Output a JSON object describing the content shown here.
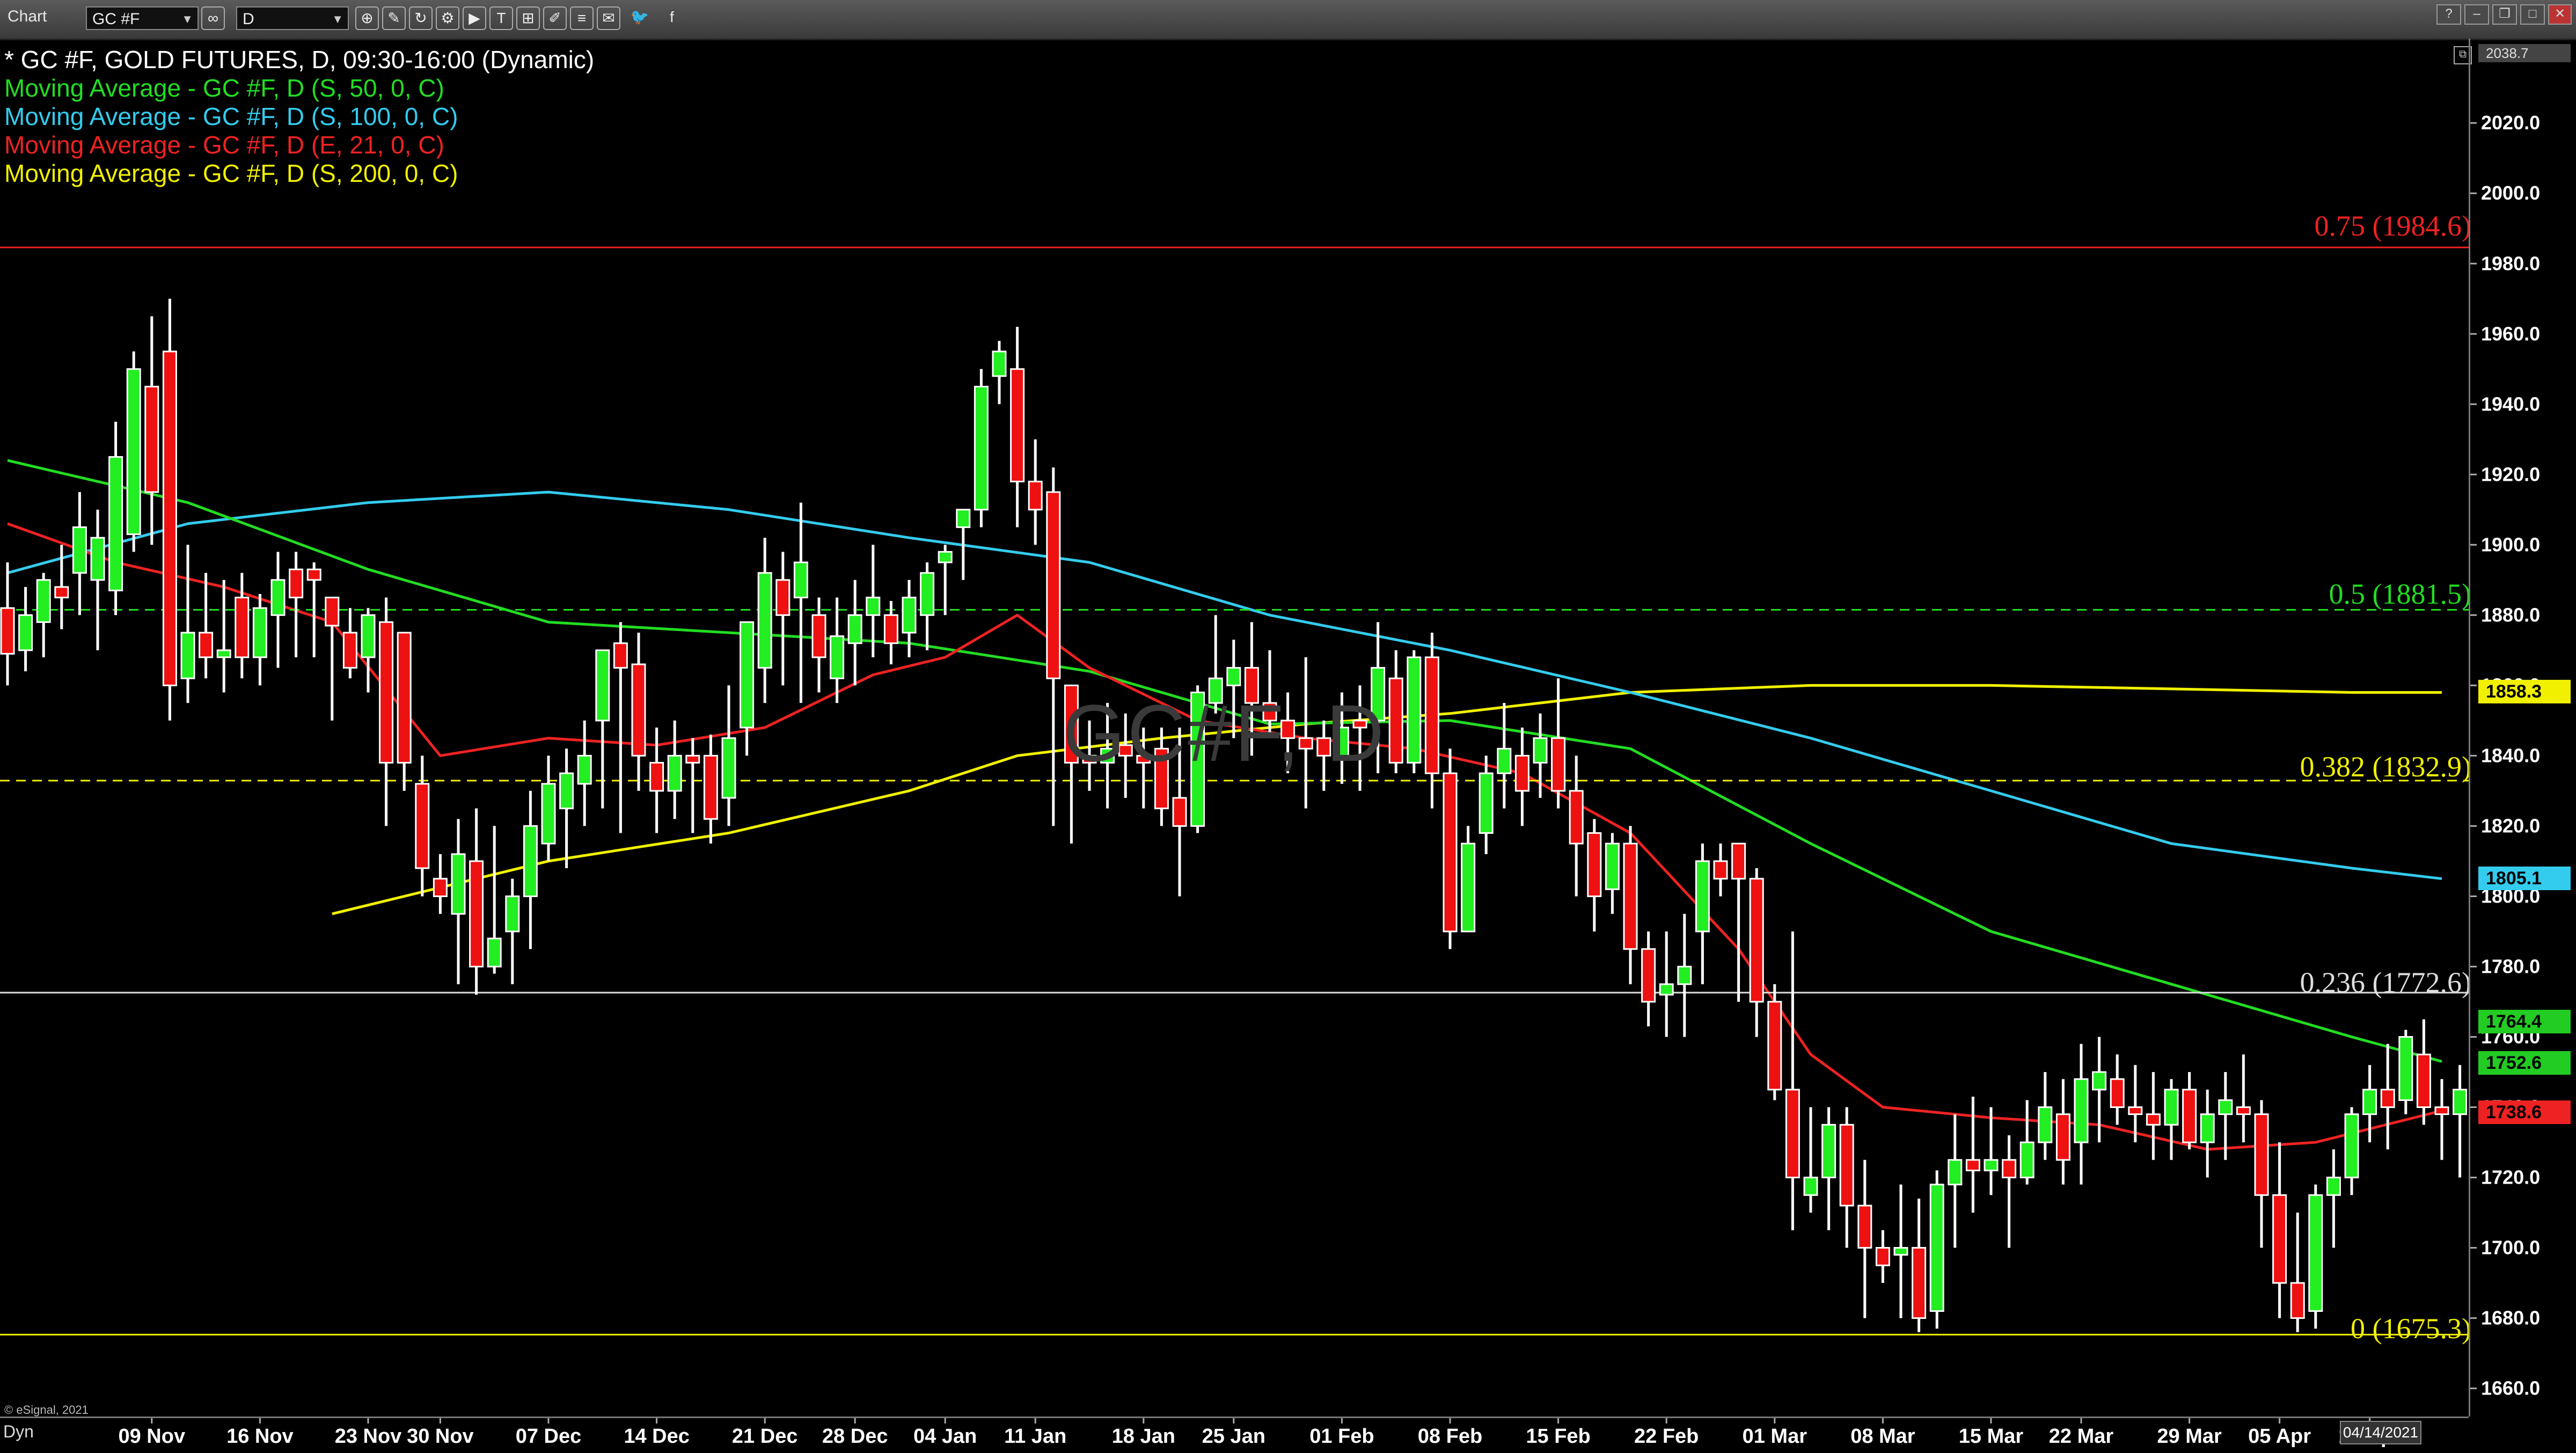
{
  "toolbar": {
    "window_title": "Chart",
    "symbol_value": "GC #F",
    "interval_value": "D",
    "icons": [
      "settings-icon",
      "draw-icon",
      "refresh-icon",
      "play-icon",
      "text-icon",
      "grid-icon",
      "tools-icon",
      "menu-icon",
      "twitter-icon",
      "facebook-icon"
    ]
  },
  "legend": [
    {
      "text": "* GC #F, GOLD FUTURES, D, 09:30-16:00 (Dynamic)",
      "color": "#ffffff"
    },
    {
      "text": "Moving Average - GC #F, D (S, 50, 0, C)",
      "color": "#22dd22"
    },
    {
      "text": "Moving Average - GC #F, D (S, 100, 0, C)",
      "color": "#33ccee"
    },
    {
      "text": "Moving Average - GC #F, D (E, 21, 0, C)",
      "color": "#ee2222"
    },
    {
      "text": "Moving Average - GC #F, D (S, 200, 0, C)",
      "color": "#f0f000"
    }
  ],
  "watermark": "GC#F, D",
  "footer": {
    "copyright": "© eSignal, 2021",
    "mode": "Dyn",
    "current_date": "04/14/2021"
  },
  "price_tags": [
    {
      "label": "2038.7",
      "value": 2038.7,
      "bg": "#444444",
      "fg": "#dddddd"
    },
    {
      "label": "1858.3",
      "value": 1858.3,
      "bg": "#f0f000",
      "fg": "#000000"
    },
    {
      "label": "1805.1",
      "value": 1805.1,
      "bg": "#33ccee",
      "fg": "#000000"
    },
    {
      "label": "1764.4",
      "value": 1764.4,
      "bg": "#22cc22",
      "fg": "#000000"
    },
    {
      "label": "1752.6",
      "value": 1752.6,
      "bg": "#22cc22",
      "fg": "#000000"
    },
    {
      "label": "1738.6",
      "value": 1738.6,
      "bg": "#ee2222",
      "fg": "#000000"
    }
  ],
  "chart_data": {
    "type": "candlestick",
    "title": "GC #F, GOLD FUTURES, D, 09:30-16:00 (Dynamic)",
    "ylim": [
      1652,
      2044
    ],
    "y_ticks": [
      1660,
      1680,
      1700,
      1720,
      1740,
      1760,
      1780,
      1800,
      1820,
      1840,
      1860,
      1880,
      1900,
      1920,
      1940,
      1960,
      1980,
      2000,
      2020
    ],
    "x_labels": [
      "09 Nov",
      "16 Nov",
      "23 Nov",
      "30 Nov",
      "07 Dec",
      "14 Dec",
      "21 Dec",
      "28 Dec",
      "04 Jan",
      "11 Jan",
      "18 Jan",
      "25 Jan",
      "01 Feb",
      "08 Feb",
      "15 Feb",
      "22 Feb",
      "01 Mar",
      "08 Mar",
      "15 Mar",
      "22 Mar",
      "29 Mar",
      "05 Apr",
      "12 Apr"
    ],
    "x_label_bar_index": [
      8,
      14,
      20,
      24,
      30,
      36,
      42,
      47,
      52,
      57,
      63,
      68,
      74,
      80,
      86,
      92,
      98,
      104,
      110,
      115,
      121,
      126,
      131
    ],
    "fibonacci": [
      {
        "label": "0.75 (1984.6)",
        "value": 1984.6,
        "color": "#ee2222",
        "style": "solid"
      },
      {
        "label": "0.5 (1881.5)",
        "value": 1881.5,
        "color": "#22dd22",
        "style": "dashed"
      },
      {
        "label": "0.382 (1832.9)",
        "value": 1832.9,
        "color": "#f0f000",
        "style": "dashed"
      },
      {
        "label": "0.236 (1772.6)",
        "value": 1772.6,
        "color": "#dddddd",
        "style": "solid"
      },
      {
        "label": "0 (1675.3)",
        "value": 1675.3,
        "color": "#f0f000",
        "style": "solid"
      }
    ],
    "ohlc": [
      [
        1882,
        1895,
        1860,
        1869
      ],
      [
        1870,
        1888,
        1864,
        1880
      ],
      [
        1878,
        1892,
        1868,
        1890
      ],
      [
        1888,
        1900,
        1876,
        1885
      ],
      [
        1892,
        1915,
        1880,
        1905
      ],
      [
        1890,
        1910,
        1870,
        1902
      ],
      [
        1887,
        1935,
        1880,
        1925
      ],
      [
        1903,
        1955,
        1898,
        1950
      ],
      [
        1945,
        1965,
        1900,
        1915
      ],
      [
        1955,
        1970,
        1850,
        1860
      ],
      [
        1862,
        1900,
        1855,
        1875
      ],
      [
        1875,
        1892,
        1862,
        1868
      ],
      [
        1868,
        1890,
        1858,
        1870
      ],
      [
        1885,
        1892,
        1862,
        1868
      ],
      [
        1868,
        1886,
        1860,
        1882
      ],
      [
        1880,
        1898,
        1865,
        1890
      ],
      [
        1893,
        1898,
        1868,
        1885
      ],
      [
        1893,
        1895,
        1868,
        1890
      ],
      [
        1885,
        1880,
        1850,
        1877
      ],
      [
        1875,
        1882,
        1862,
        1865
      ],
      [
        1868,
        1882,
        1858,
        1880
      ],
      [
        1878,
        1885,
        1820,
        1838
      ],
      [
        1875,
        1860,
        1830,
        1838
      ],
      [
        1832,
        1840,
        1800,
        1808
      ],
      [
        1805,
        1812,
        1795,
        1800
      ],
      [
        1795,
        1822,
        1775,
        1812
      ],
      [
        1810,
        1825,
        1772,
        1780
      ],
      [
        1780,
        1820,
        1778,
        1788
      ],
      [
        1790,
        1805,
        1775,
        1800
      ],
      [
        1800,
        1830,
        1785,
        1820
      ],
      [
        1815,
        1840,
        1810,
        1832
      ],
      [
        1825,
        1842,
        1808,
        1835
      ],
      [
        1832,
        1850,
        1820,
        1840
      ],
      [
        1850,
        1868,
        1825,
        1870
      ],
      [
        1872,
        1878,
        1818,
        1865
      ],
      [
        1866,
        1875,
        1830,
        1840
      ],
      [
        1838,
        1848,
        1818,
        1830
      ],
      [
        1830,
        1850,
        1822,
        1840
      ],
      [
        1840,
        1845,
        1818,
        1838
      ],
      [
        1840,
        1846,
        1815,
        1822
      ],
      [
        1828,
        1860,
        1820,
        1845
      ],
      [
        1848,
        1868,
        1840,
        1878
      ],
      [
        1865,
        1902,
        1855,
        1892
      ],
      [
        1890,
        1898,
        1860,
        1880
      ],
      [
        1885,
        1912,
        1855,
        1895
      ],
      [
        1880,
        1885,
        1858,
        1868
      ],
      [
        1862,
        1885,
        1855,
        1874
      ],
      [
        1872,
        1890,
        1860,
        1880
      ],
      [
        1880,
        1900,
        1868,
        1885
      ],
      [
        1880,
        1884,
        1866,
        1872
      ],
      [
        1875,
        1890,
        1868,
        1885
      ],
      [
        1880,
        1895,
        1870,
        1892
      ],
      [
        1895,
        1900,
        1880,
        1898
      ],
      [
        1905,
        1910,
        1890,
        1910
      ],
      [
        1910,
        1950,
        1905,
        1945
      ],
      [
        1948,
        1958,
        1940,
        1955
      ],
      [
        1950,
        1962,
        1905,
        1918
      ],
      [
        1918,
        1930,
        1900,
        1910
      ],
      [
        1915,
        1922,
        1820,
        1862
      ],
      [
        1860,
        1848,
        1815,
        1838
      ],
      [
        1840,
        1850,
        1830,
        1838
      ],
      [
        1838,
        1855,
        1825,
        1842
      ],
      [
        1843,
        1852,
        1828,
        1840
      ],
      [
        1840,
        1848,
        1825,
        1838
      ],
      [
        1842,
        1848,
        1820,
        1825
      ],
      [
        1828,
        1848,
        1800,
        1820
      ],
      [
        1820,
        1860,
        1818,
        1858
      ],
      [
        1855,
        1880,
        1852,
        1862
      ],
      [
        1860,
        1873,
        1845,
        1865
      ],
      [
        1865,
        1878,
        1840,
        1855
      ],
      [
        1855,
        1870,
        1845,
        1850
      ],
      [
        1850,
        1858,
        1835,
        1845
      ],
      [
        1845,
        1868,
        1825,
        1842
      ],
      [
        1845,
        1850,
        1830,
        1840
      ],
      [
        1840,
        1858,
        1832,
        1848
      ],
      [
        1850,
        1860,
        1830,
        1848
      ],
      [
        1850,
        1878,
        1835,
        1865
      ],
      [
        1862,
        1870,
        1835,
        1838
      ],
      [
        1838,
        1870,
        1835,
        1868
      ],
      [
        1868,
        1875,
        1825,
        1835
      ],
      [
        1835,
        1842,
        1785,
        1790
      ],
      [
        1790,
        1820,
        1800,
        1815
      ],
      [
        1818,
        1840,
        1812,
        1835
      ],
      [
        1835,
        1855,
        1825,
        1842
      ],
      [
        1840,
        1848,
        1820,
        1830
      ],
      [
        1838,
        1852,
        1828,
        1845
      ],
      [
        1845,
        1862,
        1825,
        1830
      ],
      [
        1830,
        1840,
        1800,
        1815
      ],
      [
        1818,
        1822,
        1790,
        1800
      ],
      [
        1802,
        1818,
        1795,
        1815
      ],
      [
        1815,
        1820,
        1775,
        1785
      ],
      [
        1785,
        1790,
        1763,
        1770
      ],
      [
        1772,
        1790,
        1760,
        1775
      ],
      [
        1775,
        1795,
        1760,
        1780
      ],
      [
        1790,
        1815,
        1775,
        1810
      ],
      [
        1810,
        1815,
        1800,
        1805
      ],
      [
        1815,
        1812,
        1770,
        1805
      ],
      [
        1805,
        1808,
        1760,
        1770
      ],
      [
        1770,
        1775,
        1742,
        1745
      ],
      [
        1745,
        1790,
        1705,
        1720
      ],
      [
        1715,
        1740,
        1710,
        1720
      ],
      [
        1720,
        1740,
        1705,
        1735
      ],
      [
        1735,
        1740,
        1700,
        1712
      ],
      [
        1712,
        1725,
        1680,
        1700
      ],
      [
        1700,
        1705,
        1690,
        1695
      ],
      [
        1698,
        1718,
        1680,
        1700
      ],
      [
        1700,
        1714,
        1676,
        1680
      ],
      [
        1682,
        1722,
        1677,
        1718
      ],
      [
        1718,
        1738,
        1700,
        1725
      ],
      [
        1725,
        1743,
        1710,
        1722
      ],
      [
        1722,
        1740,
        1715,
        1725
      ],
      [
        1725,
        1732,
        1700,
        1720
      ],
      [
        1720,
        1742,
        1718,
        1730
      ],
      [
        1730,
        1750,
        1725,
        1740
      ],
      [
        1738,
        1748,
        1718,
        1725
      ],
      [
        1730,
        1758,
        1718,
        1748
      ],
      [
        1745,
        1760,
        1730,
        1750
      ],
      [
        1748,
        1755,
        1735,
        1740
      ],
      [
        1740,
        1752,
        1730,
        1738
      ],
      [
        1738,
        1750,
        1725,
        1735
      ],
      [
        1735,
        1748,
        1725,
        1745
      ],
      [
        1745,
        1750,
        1728,
        1730
      ],
      [
        1730,
        1745,
        1720,
        1738
      ],
      [
        1738,
        1750,
        1725,
        1742
      ],
      [
        1740,
        1755,
        1730,
        1738
      ],
      [
        1738,
        1742,
        1700,
        1715
      ],
      [
        1715,
        1730,
        1680,
        1690
      ],
      [
        1690,
        1710,
        1676,
        1680
      ],
      [
        1682,
        1718,
        1677,
        1715
      ],
      [
        1715,
        1728,
        1700,
        1720
      ],
      [
        1720,
        1740,
        1715,
        1738
      ],
      [
        1738,
        1752,
        1730,
        1745
      ],
      [
        1745,
        1758,
        1728,
        1740
      ],
      [
        1742,
        1762,
        1738,
        1760
      ],
      [
        1755,
        1765,
        1735,
        1740
      ],
      [
        1740,
        1748,
        1725,
        1738
      ],
      [
        1738,
        1752,
        1720,
        1745
      ],
      [
        1748,
        1752,
        1730,
        1742
      ],
      [
        1740,
        1768,
        1735,
        1764
      ]
    ],
    "ma_50_simple": {
      "name": "Moving Average - GC #F, D (S, 50, 0, C)",
      "color": "#22dd22",
      "x": [
        0,
        10,
        20,
        30,
        40,
        50,
        60,
        70,
        80,
        90,
        100,
        110,
        120,
        130,
        135
      ],
      "y": [
        1924,
        1912,
        1893,
        1878,
        1875,
        1872,
        1864,
        1849,
        1850,
        1842,
        1815,
        1790,
        1775,
        1760,
        1753
      ]
    },
    "ma_100_simple": {
      "name": "Moving Average - GC #F, D (S, 100, 0, C)",
      "color": "#33ccee",
      "x": [
        0,
        10,
        20,
        30,
        40,
        50,
        60,
        70,
        80,
        90,
        100,
        110,
        120,
        130,
        135
      ],
      "y": [
        1892,
        1906,
        1912,
        1915,
        1910,
        1902,
        1895,
        1880,
        1870,
        1858,
        1845,
        1830,
        1815,
        1808,
        1805
      ]
    },
    "ema_21": {
      "name": "Moving Average - GC #F, D (E, 21, 0, C)",
      "color": "#ee2222",
      "x": [
        0,
        6,
        12,
        18,
        24,
        30,
        36,
        42,
        48,
        52,
        56,
        60,
        66,
        72,
        78,
        84,
        90,
        96,
        100,
        104,
        110,
        116,
        122,
        128,
        135
      ],
      "y": [
        1906,
        1895,
        1888,
        1878,
        1840,
        1845,
        1843,
        1848,
        1863,
        1868,
        1880,
        1865,
        1850,
        1845,
        1842,
        1835,
        1818,
        1785,
        1755,
        1740,
        1737,
        1735,
        1728,
        1730,
        1739
      ]
    },
    "ma_200_simple": {
      "name": "Moving Average - GC #F, D (S, 200, 0, C)",
      "color": "#f0f000",
      "x": [
        18,
        30,
        40,
        50,
        56,
        64,
        72,
        80,
        90,
        100,
        110,
        120,
        130,
        135
      ],
      "y": [
        1795,
        1810,
        1818,
        1830,
        1840,
        1845,
        1849,
        1852,
        1858,
        1860,
        1860,
        1859,
        1858,
        1858
      ]
    }
  }
}
